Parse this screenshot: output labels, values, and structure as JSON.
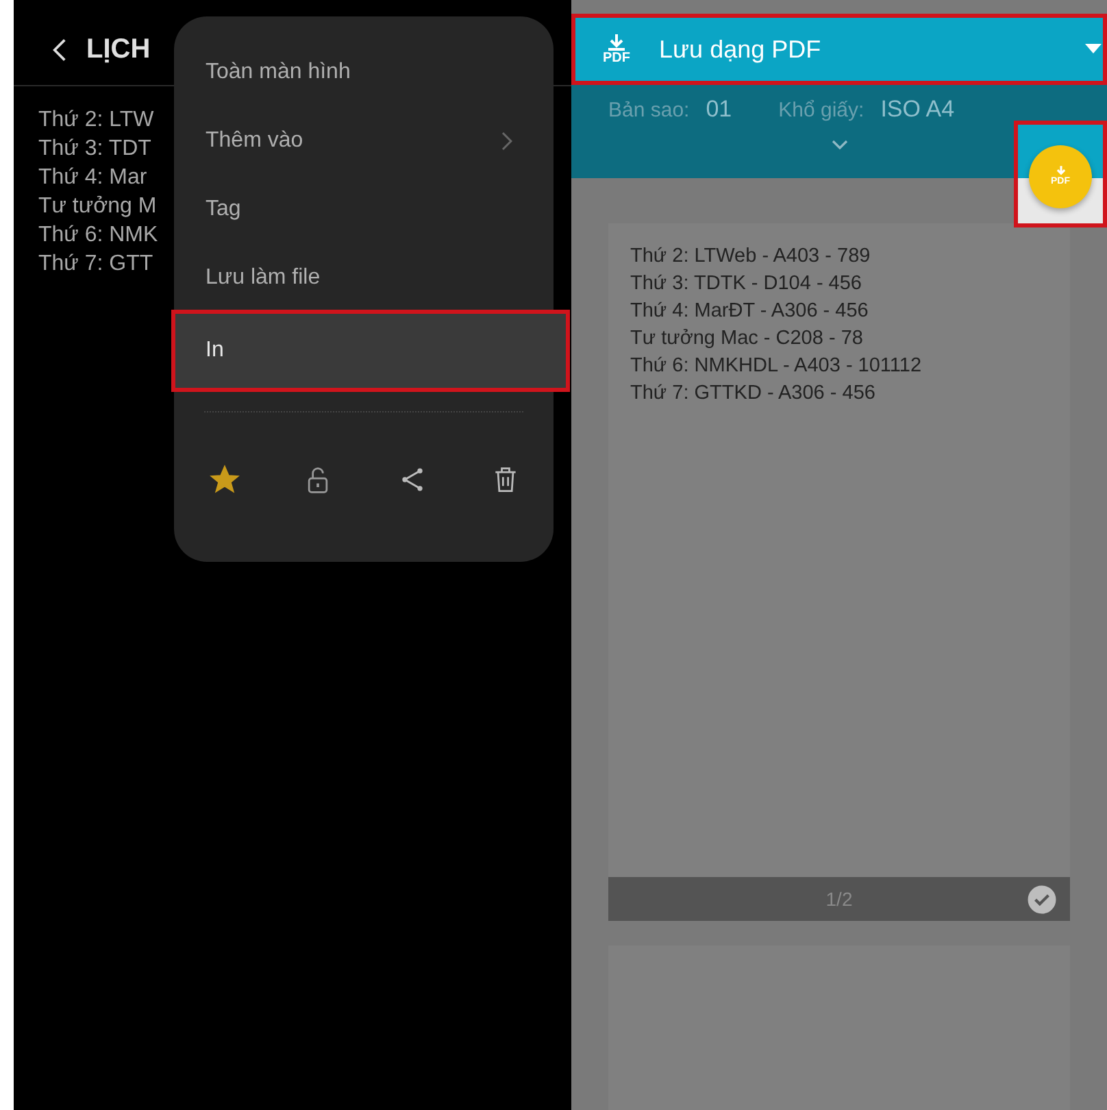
{
  "note_screen": {
    "title": "LỊCH",
    "lines": [
      "Thứ 2: LTW",
      "Thứ 3: TDT",
      "Thứ 4: Mar",
      "Tư tưởng M",
      "Thứ 6: NMK",
      "Thứ 7: GTT"
    ]
  },
  "menu": {
    "items": [
      {
        "label": "Toàn màn hình",
        "selected": false,
        "highlighted": false,
        "submenu": false
      },
      {
        "label": "Thêm vào",
        "selected": false,
        "highlighted": false,
        "submenu": true
      },
      {
        "label": "Tag",
        "selected": false,
        "highlighted": false,
        "submenu": false
      },
      {
        "label": "Lưu làm file",
        "selected": false,
        "highlighted": false,
        "submenu": false
      },
      {
        "label": "In",
        "selected": true,
        "highlighted": true,
        "submenu": false
      }
    ],
    "actions": [
      {
        "kind": "star",
        "on": true
      },
      {
        "kind": "lock"
      },
      {
        "kind": "share"
      },
      {
        "kind": "delete"
      }
    ]
  },
  "print_screen": {
    "printer": {
      "label": "Lưu dạng PDF",
      "icon_label": "PDF",
      "highlighted": true
    },
    "settings": [
      {
        "label": "Bản sao:",
        "value": "01"
      },
      {
        "label": "Khổ giấy:",
        "value": "ISO A4"
      }
    ],
    "fab": {
      "icon_label": "PDF",
      "highlighted": true
    },
    "pages": [
      {
        "kind": "content",
        "lines": [
          "Thứ 2: LTWeb - A403 - 789",
          "Thứ 3: TDTK - D104 - 456",
          "Thứ 4: MarĐT - A306 - 456",
          "Tư tưởng Mac - C208 - 78",
          "Thứ 6: NMKHDL - A403 - 101112",
          "Thứ 7: GTTKD - A306 - 456"
        ],
        "number": "1/2",
        "selected": true
      },
      {
        "kind": "blank"
      }
    ]
  }
}
